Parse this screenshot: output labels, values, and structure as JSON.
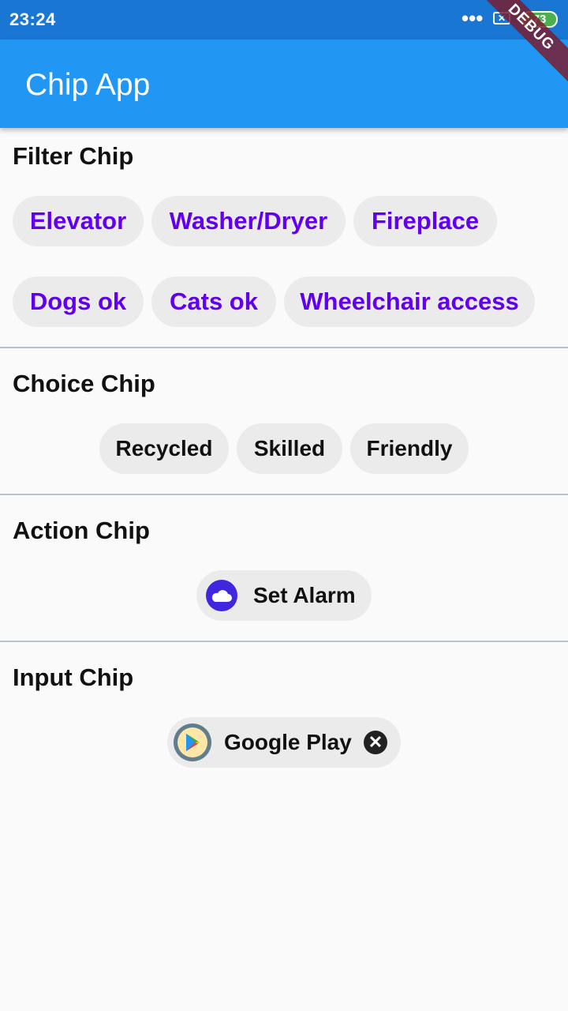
{
  "status_bar": {
    "time": "23:24",
    "dots": "•••",
    "sim": "✕",
    "battery": "73"
  },
  "app_bar": {
    "title": "Chip App",
    "debug_label": "DEBUG"
  },
  "filter_section": {
    "title": "Filter Chip",
    "chips": [
      "Elevator",
      "Washer/Dryer",
      "Fireplace",
      "Dogs ok",
      "Cats ok",
      "Wheelchair access"
    ]
  },
  "choice_section": {
    "title": "Choice Chip",
    "chips": [
      "Recycled",
      "Skilled",
      "Friendly"
    ]
  },
  "action_section": {
    "title": "Action Chip",
    "chip": {
      "label": "Set Alarm",
      "icon": "cloud-icon",
      "icon_color": "#3f27e0"
    }
  },
  "input_section": {
    "title": "Input Chip",
    "chip": {
      "label": "Google Play",
      "icon": "google-play-icon",
      "delete_icon": "close-icon",
      "delete_glyph": "✕"
    }
  },
  "colors": {
    "status_bar": "#1976d2",
    "app_bar": "#2196f3",
    "filter_text": "#6200ee",
    "chip_bg": "#ebebeb",
    "background": "#fafafa"
  }
}
